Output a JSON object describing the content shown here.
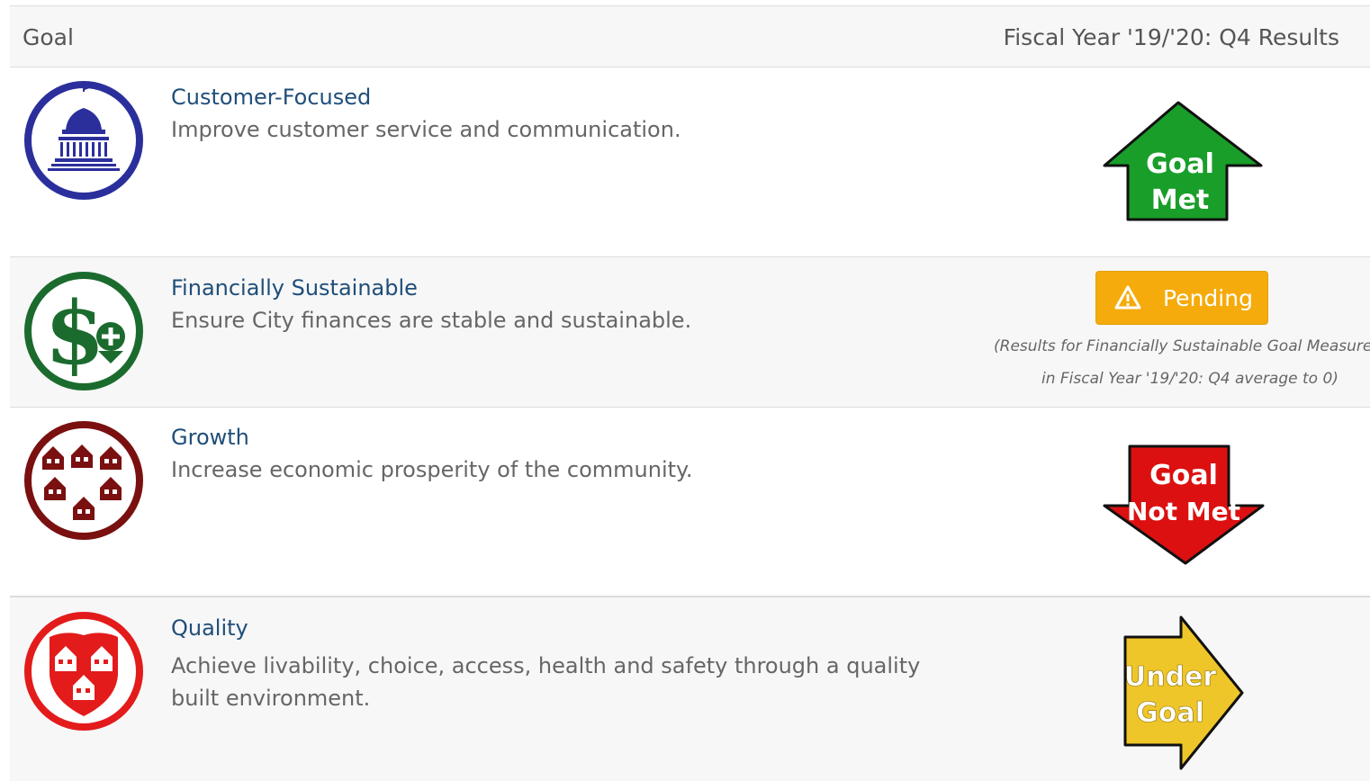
{
  "header": {
    "goal_label": "Goal",
    "results_label": "Fiscal Year '19/'20: Q4 Results"
  },
  "goals": [
    {
      "title": "Customer-Focused",
      "description": "Improve customer service and communication.",
      "icon": "capitol-building-icon",
      "result": {
        "type": "arrow-up",
        "line1": "Goal",
        "line2": "Met",
        "color": "#1a9e2a"
      }
    },
    {
      "title": "Financially Sustainable",
      "description": "Ensure City finances are stable and sustainable.",
      "icon": "dollar-sign-icon",
      "result": {
        "type": "pending",
        "label": "Pending",
        "color": "#f5ab0c",
        "note_line1": "(Results for Financially Sustainable Goal Measures",
        "note_line2": "in Fiscal Year '19/'20: Q4 average to 0)"
      }
    },
    {
      "title": "Growth",
      "description": "Increase economic prosperity of the community.",
      "icon": "houses-icon",
      "result": {
        "type": "arrow-down",
        "line1": "Goal",
        "line2": "Not Met",
        "color": "#dc1010"
      }
    },
    {
      "title": "Quality",
      "description": "Achieve livability, choice, access, health and safety through a quality built environment.",
      "icon": "shield-houses-icon",
      "result": {
        "type": "arrow-right",
        "line1": "Under",
        "line2": "Goal",
        "color": "#eec62a"
      }
    }
  ],
  "colors": {
    "link": "#1f4e79",
    "customer_icon": "#2b2f9c",
    "financial_icon": "#1b6b2e",
    "growth_icon": "#7a1010",
    "quality_icon": "#e31b1b"
  }
}
